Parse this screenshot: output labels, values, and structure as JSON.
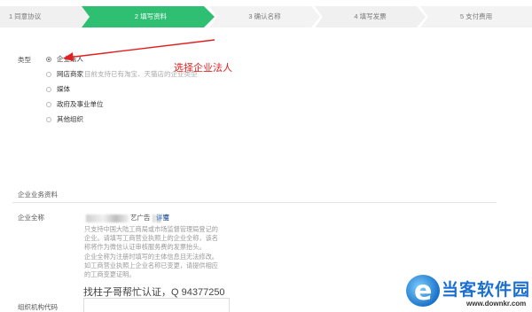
{
  "steps": [
    {
      "label": "1 同意协议"
    },
    {
      "label": "2 填写资料"
    },
    {
      "label": "3 确认名称"
    },
    {
      "label": "4 填写发票"
    },
    {
      "label": "5 支付费用"
    }
  ],
  "active_step_color": "#2fbf73",
  "type_section": {
    "label": "类型",
    "options": [
      {
        "label": "企业法人",
        "checked": true,
        "hint": ""
      },
      {
        "label": "网店商家",
        "checked": false,
        "hint": "目前支持已有淘宝、天猫店的企业类型"
      },
      {
        "label": "媒体",
        "checked": false,
        "hint": ""
      },
      {
        "label": "政府及事业单位",
        "checked": false,
        "hint": ""
      },
      {
        "label": "其他组织",
        "checked": false,
        "hint": ""
      }
    ]
  },
  "annotation": {
    "text": "选择企业法人",
    "color": "#e02020"
  },
  "business_section": {
    "title": "企业业务资料",
    "full_name": {
      "label": "企业全称",
      "value_prefix": "",
      "value_suffix": "艺广告",
      "value_end": "室",
      "detail_link": "详情"
    },
    "help_lines": [
      "只支持中国大陆工商局或市场监督管理局登记的",
      "企业。请填写工商营业执照上的企业全称，该名",
      "称将作为微信认证审核服务费的发票抬头。",
      "企业全称为注册时填写的主体信息且无法修改。",
      "如工商营业执照上企业名称已变更，请提供相应",
      "的工商变更证明。"
    ],
    "watermark_line": "找柱子哥帮忙认证，Q 94377250",
    "org_code": {
      "label": "组织机构代码",
      "value": "",
      "placeholder": ""
    }
  },
  "logo": {
    "name": "当客软件园",
    "url": "www.downkr.com"
  }
}
